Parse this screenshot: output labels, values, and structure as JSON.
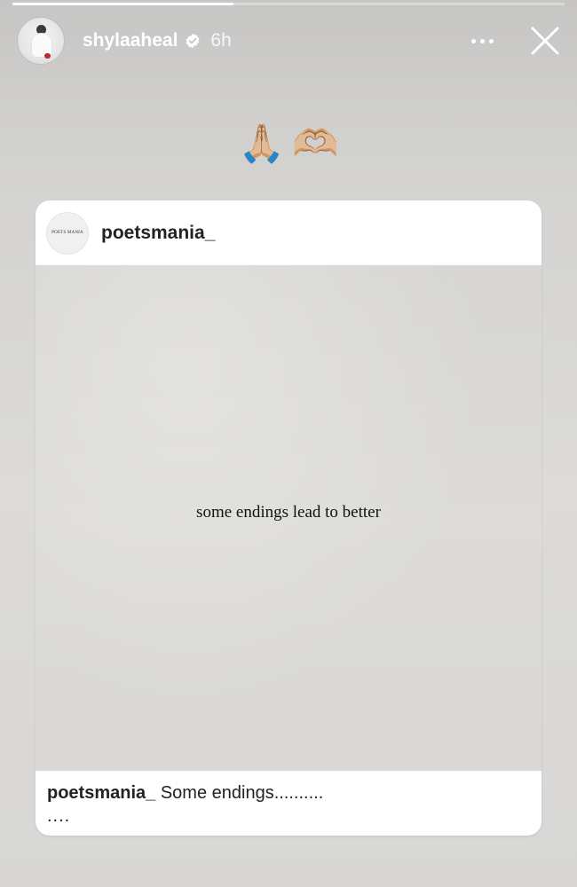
{
  "story": {
    "progress": 0.4,
    "username": "shylaaheal",
    "verified": true,
    "time": "6h",
    "emojis": [
      "🙏🏼",
      "🫶🏼"
    ]
  },
  "post": {
    "username": "poetsmania_",
    "avatar_text": "POETS MANIA",
    "quote": "some endings lead to better",
    "caption_user": "poetsmania_",
    "caption_text": "Some endings..........",
    "caption_more": "...."
  },
  "icons": {
    "verified": "verified-badge-icon",
    "more": "more-options-icon",
    "close": "close-icon"
  },
  "colors": {
    "background": "#d6d5d3",
    "card": "#ffffff",
    "text_light": "#ffffff",
    "text_dark": "#222222"
  }
}
